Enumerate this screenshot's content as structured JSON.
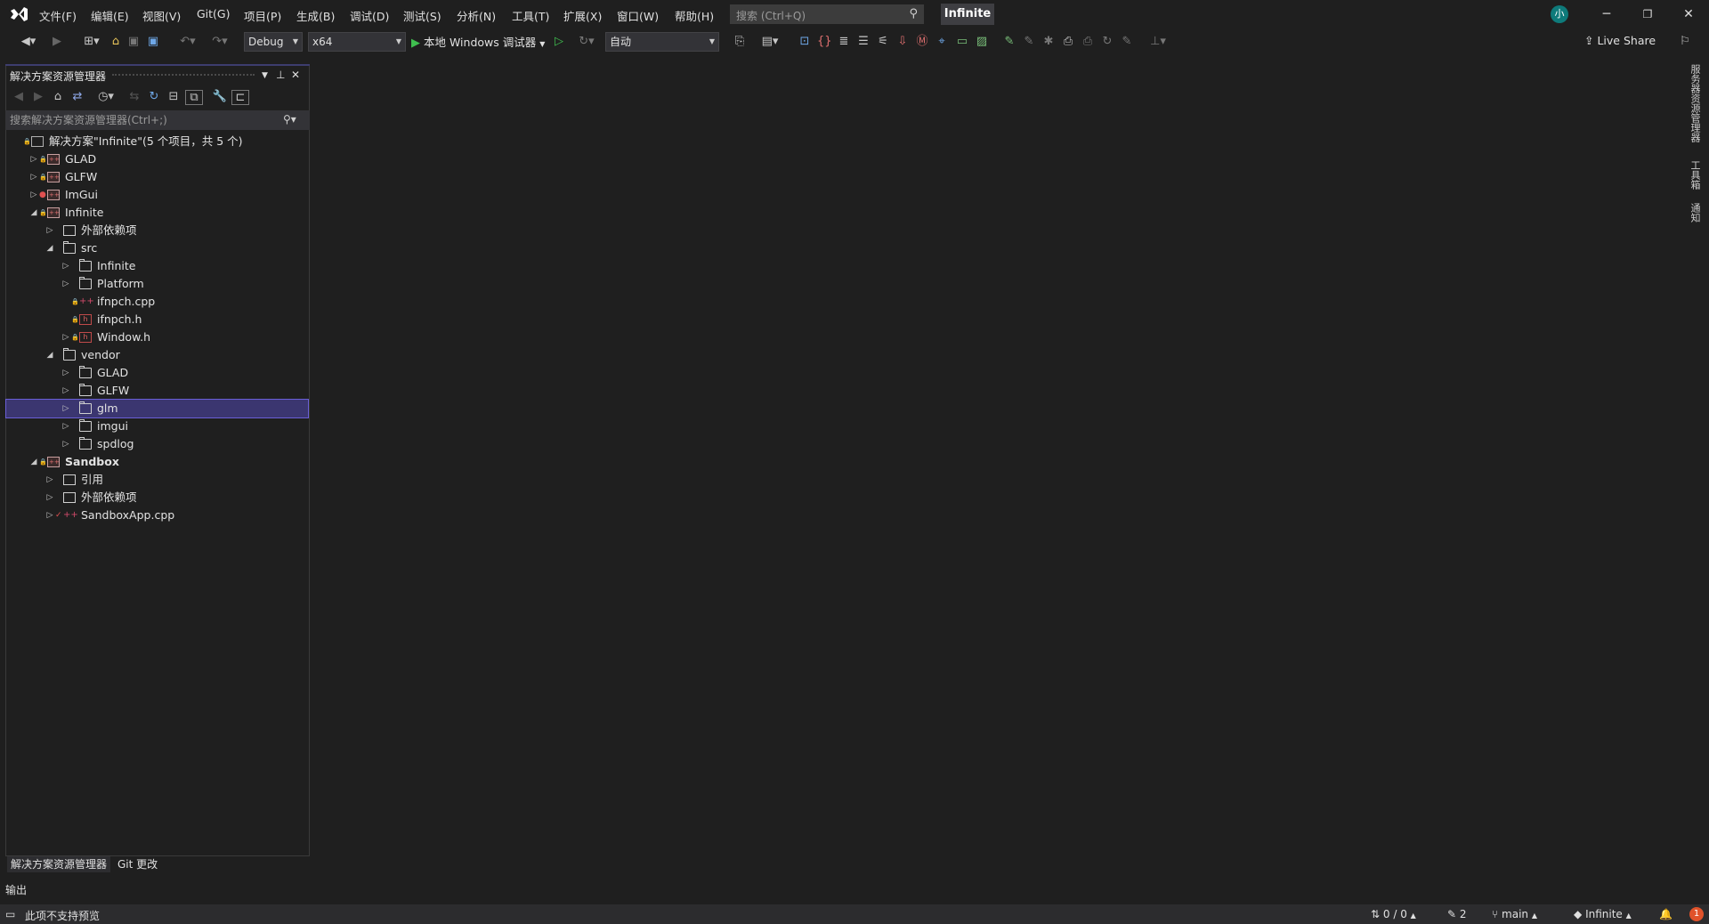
{
  "menu": [
    "文件(F)",
    "编辑(E)",
    "视图(V)",
    "Git(G)",
    "项目(P)",
    "生成(B)",
    "调试(D)",
    "测试(S)",
    "分析(N)",
    "工具(T)",
    "扩展(X)",
    "窗口(W)",
    "帮助(H)"
  ],
  "search": {
    "placeholder": "搜索 (Ctrl+Q)"
  },
  "solution_badge": "Infinite",
  "avatar": "小",
  "toolbar": {
    "config": "Debug",
    "platform": "x64",
    "run_label": "本地 Windows 调试器",
    "auto": "自动",
    "live_share": "Live Share"
  },
  "solution_explorer": {
    "title": "解决方案资源管理器",
    "search_placeholder": "搜索解决方案资源管理器(Ctrl+;)",
    "tree": [
      {
        "label": "解决方案\"Infinite\"(5 个项目，共 5 个)",
        "level": 0,
        "expander": "",
        "icon": "sol",
        "lock": true,
        "bold": false
      },
      {
        "label": "GLAD",
        "level": 1,
        "expander": "right",
        "icon": "proj",
        "lock": true
      },
      {
        "label": "GLFW",
        "level": 1,
        "expander": "right",
        "icon": "proj",
        "lock": true
      },
      {
        "label": "ImGui",
        "level": 1,
        "expander": "right",
        "icon": "proj",
        "lock": false,
        "dot": true
      },
      {
        "label": "Infinite",
        "level": 1,
        "expander": "down",
        "icon": "proj",
        "lock": true
      },
      {
        "label": "外部依赖项",
        "level": 2,
        "expander": "right",
        "icon": "ref"
      },
      {
        "label": "src",
        "level": 2,
        "expander": "down",
        "icon": "folder"
      },
      {
        "label": "Infinite",
        "level": 3,
        "expander": "right",
        "icon": "folder"
      },
      {
        "label": "Platform",
        "level": 3,
        "expander": "right",
        "icon": "folder"
      },
      {
        "label": "ifnpch.cpp",
        "level": 3,
        "expander": "",
        "icon": "cpp",
        "lock": true
      },
      {
        "label": "ifnpch.h",
        "level": 3,
        "expander": "",
        "icon": "hdr",
        "lock": true
      },
      {
        "label": "Window.h",
        "level": 3,
        "expander": "right",
        "icon": "hdr",
        "lock": true
      },
      {
        "label": "vendor",
        "level": 2,
        "expander": "down",
        "icon": "folder"
      },
      {
        "label": "GLAD",
        "level": 3,
        "expander": "right",
        "icon": "folder"
      },
      {
        "label": "GLFW",
        "level": 3,
        "expander": "right",
        "icon": "folder"
      },
      {
        "label": "glm",
        "level": 3,
        "expander": "right",
        "icon": "folder",
        "selected": true
      },
      {
        "label": "imgui",
        "level": 3,
        "expander": "right",
        "icon": "folder"
      },
      {
        "label": "spdlog",
        "level": 3,
        "expander": "right",
        "icon": "folder"
      },
      {
        "label": "Sandbox",
        "level": 1,
        "expander": "down",
        "icon": "proj",
        "lock": true,
        "bold": true
      },
      {
        "label": "引用",
        "level": 2,
        "expander": "right",
        "icon": "ref"
      },
      {
        "label": "外部依赖项",
        "level": 2,
        "expander": "right",
        "icon": "ref"
      },
      {
        "label": "SandboxApp.cpp",
        "level": 2,
        "expander": "right",
        "icon": "cpp",
        "check": true
      }
    ]
  },
  "bottom_tabs": [
    "解决方案资源管理器",
    "Git 更改"
  ],
  "output_title": "输出",
  "right_tabs": [
    "服务器资源管理器",
    "工具箱",
    "通知"
  ],
  "status": {
    "preview": "此项不支持预览",
    "sync": "0 / 0",
    "edits": "2",
    "branch": "main",
    "repo": "Infinite",
    "notifications": "1"
  }
}
